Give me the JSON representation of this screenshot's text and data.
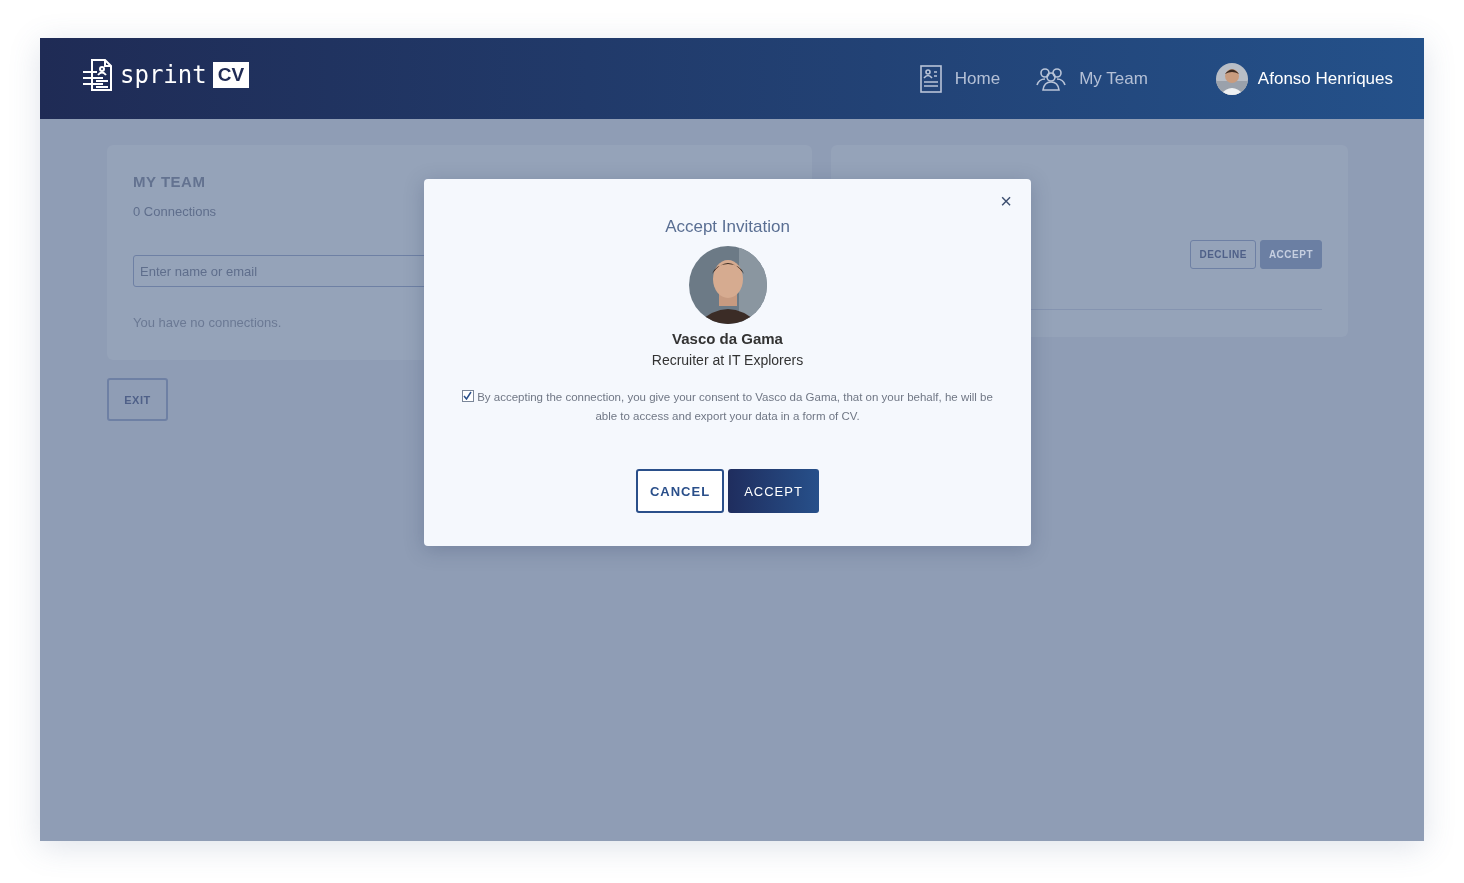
{
  "header": {
    "logo": {
      "word": "sprint",
      "badge": "CV"
    },
    "nav": [
      {
        "label": "Home"
      },
      {
        "label": "My Team"
      }
    ],
    "user": {
      "name": "Afonso Henriques"
    }
  },
  "my_team": {
    "title": "MY TEAM",
    "count": "0 Connections",
    "search": {
      "placeholder": "Enter name or email"
    },
    "empty_message": "You have no connections."
  },
  "exit_button": "EXIT",
  "pending": {
    "buttons": [
      {
        "label": "DECLINE",
        "kind": "outline"
      },
      {
        "label": "ACCEPT",
        "kind": "primary"
      }
    ]
  },
  "dialog": {
    "close": "×",
    "title": "Accept Invitation",
    "name": "Vasco da Gama",
    "role": "Recruiter at IT Explorers",
    "consent": {
      "checked": true,
      "text": "By accepting the connection, you give your consent to Vasco da Gama, that on your behalf, he will be able to access and export your data in a form of CV."
    },
    "buttons": [
      {
        "label": "CANCEL",
        "kind": "outline"
      },
      {
        "label": "ACCEPT",
        "kind": "primary"
      }
    ]
  }
}
